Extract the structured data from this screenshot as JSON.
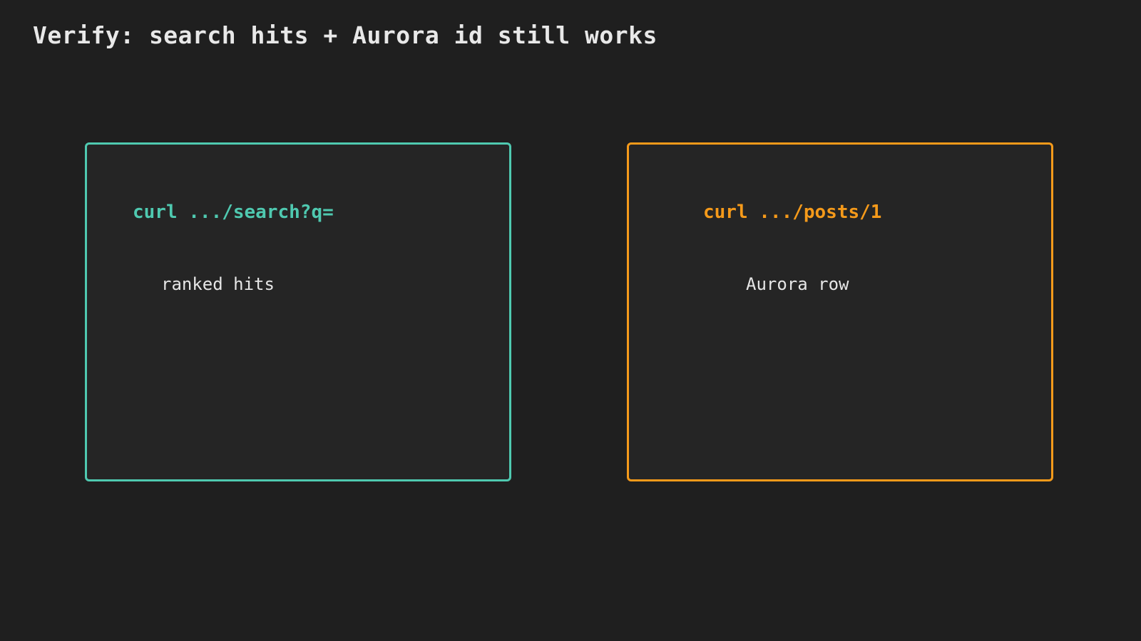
{
  "title": "Verify: search hits + Aurora id still works",
  "colors": {
    "background": "#1f1f1f",
    "card_background": "#252525",
    "teal": "#4fc9b0",
    "orange": "#f59a1a",
    "text": "#e6e6e6"
  },
  "panels": [
    {
      "command": "curl .../search?q=",
      "result": "ranked hits",
      "accent": "#4fc9b0"
    },
    {
      "command": "curl .../posts/1",
      "result": "Aurora row",
      "accent": "#f59a1a"
    }
  ]
}
